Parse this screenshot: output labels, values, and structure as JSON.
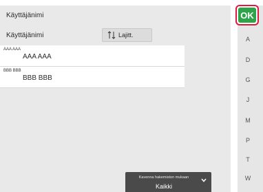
{
  "title": "Käyttäjänimi",
  "header": {
    "column_label": "Käyttäjänimi",
    "sort_label": "Lajitt."
  },
  "rows": [
    {
      "search_key": "AAA AAA",
      "name": "AAA AAA"
    },
    {
      "search_key": "BBB BBB",
      "name": "BBB BBB"
    }
  ],
  "index_letters": [
    "A",
    "D",
    "G",
    "J",
    "M",
    "P",
    "T",
    "W"
  ],
  "ok_label": "OK",
  "filter": {
    "caption": "Kavenna hakemiston mukaan",
    "value": "Kaikki"
  },
  "colors": {
    "ok_green": "#2ea34a",
    "ok_highlight": "#e2173b"
  }
}
